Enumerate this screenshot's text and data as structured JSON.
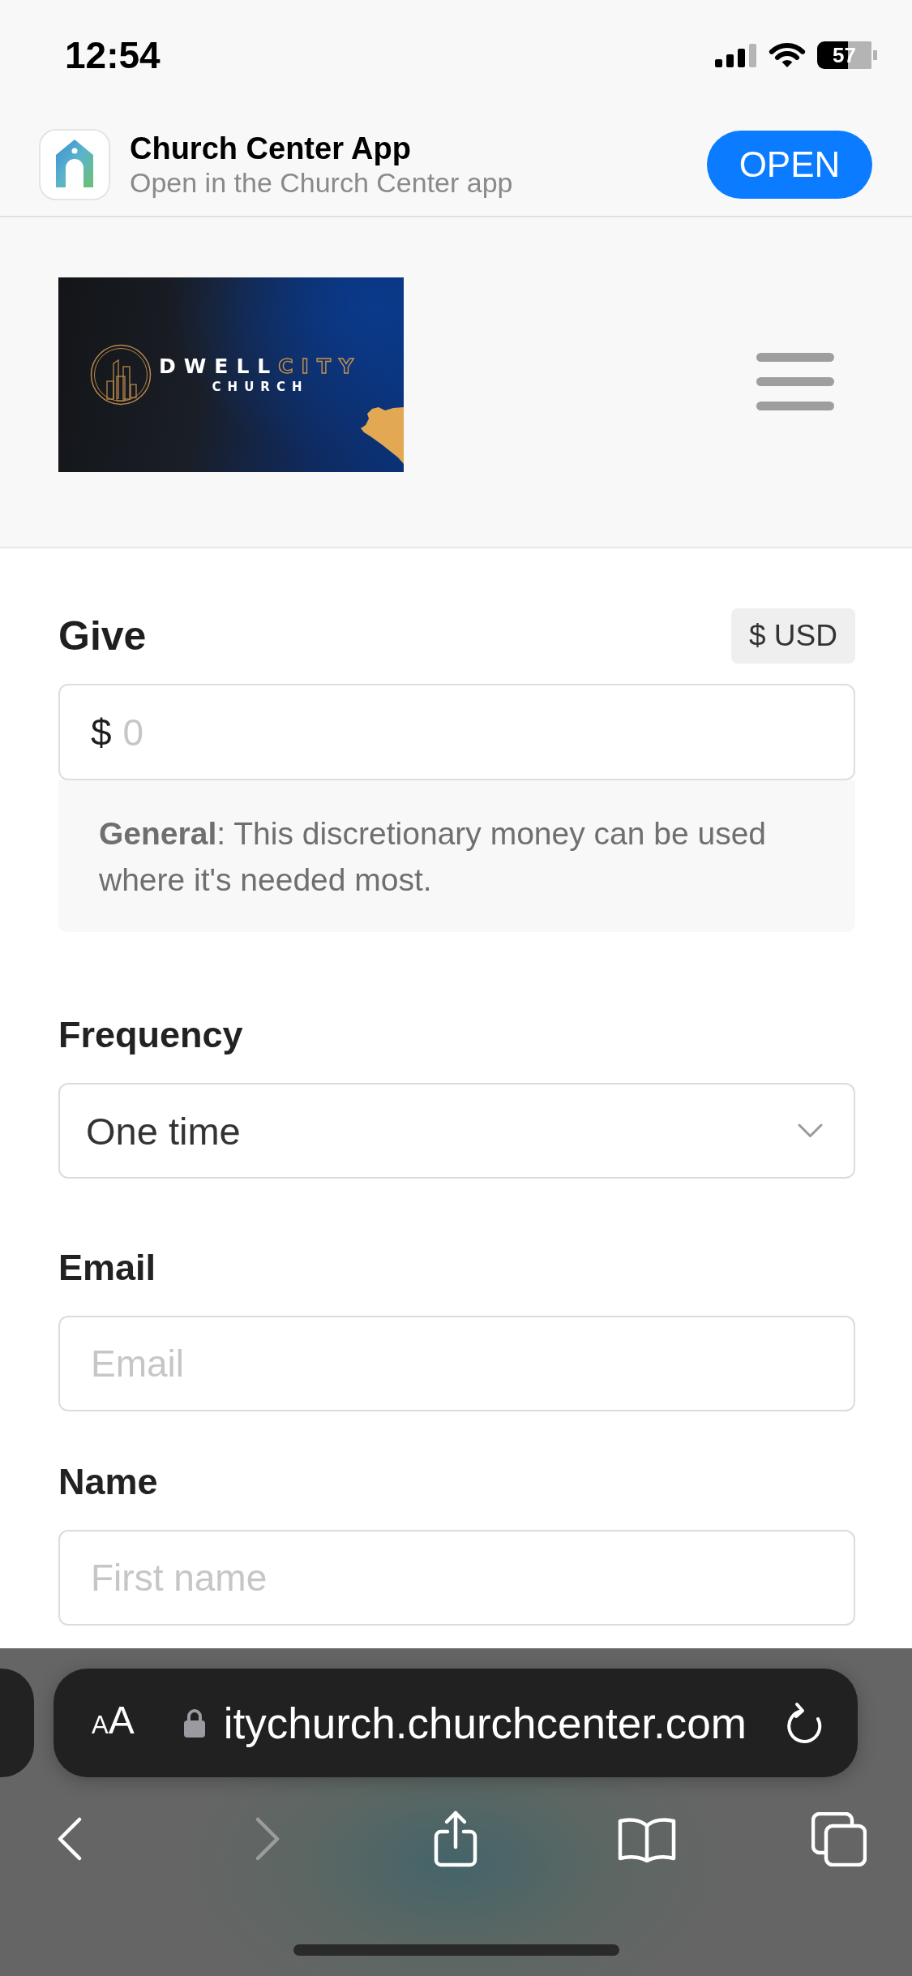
{
  "status_bar": {
    "time": "12:54",
    "battery": "57"
  },
  "app_banner": {
    "title": "Church Center App",
    "subtitle": "Open in the Church Center app",
    "button": "OPEN"
  },
  "header": {
    "logo": {
      "word_1": "DWELL",
      "word_2": "CITY",
      "line_2": "CHURCH"
    }
  },
  "give": {
    "title": "Give",
    "currency": "$ USD",
    "amount": {
      "prefix": "$",
      "placeholder": "0"
    },
    "fund_description": "**General**: This discretionary money can be used where it's needed most."
  },
  "fields": [
    {
      "kind": "select",
      "label": "Frequency",
      "value": "One time"
    },
    {
      "kind": "input",
      "label": "Email",
      "placeholder": "Email"
    },
    {
      "kind": "input",
      "label": "Name",
      "placeholder": "First name"
    }
  ],
  "browser": {
    "text_size": "AA",
    "url": "itychurch.churchcenter.com",
    "toolbar": [
      {
        "kind": "back",
        "disabled": false
      },
      {
        "kind": "forward",
        "disabled": true
      },
      {
        "kind": "share",
        "disabled": false
      },
      {
        "kind": "bookmarks",
        "disabled": false
      },
      {
        "kind": "tabs",
        "disabled": false
      }
    ]
  }
}
